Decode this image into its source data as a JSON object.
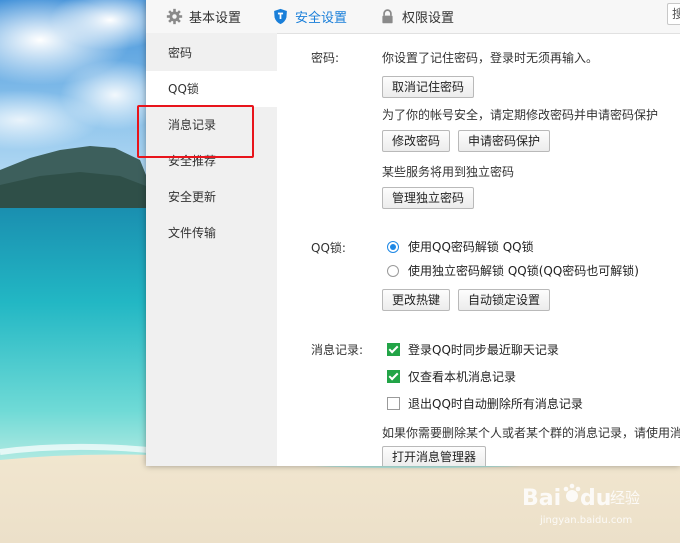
{
  "tabs": [
    {
      "label": "基本设置",
      "icon": "gear-icon"
    },
    {
      "label": "安全设置",
      "icon": "shield-icon",
      "active": true
    },
    {
      "label": "权限设置",
      "icon": "lock-icon"
    }
  ],
  "search": {
    "value": "搜"
  },
  "sidebar": {
    "items": [
      {
        "label": "密码"
      },
      {
        "label": "QQ锁",
        "active": true
      },
      {
        "label": "消息记录"
      },
      {
        "label": "安全推荐"
      },
      {
        "label": "安全更新"
      },
      {
        "label": "文件传输"
      }
    ]
  },
  "password": {
    "label": "密码:",
    "remembered_text": "你设置了记住密码，登录时无须再输入。",
    "cancel_remember_button": "取消记住密码",
    "advice_text": "为了你的帐号安全，请定期修改密码并申请密码保护",
    "change_password_button": "修改密码",
    "apply_protection_button": "申请密码保护",
    "independent_text": "某些服务将用到独立密码",
    "manage_independent_button": "管理独立密码"
  },
  "qqlock": {
    "label": "QQ锁:",
    "option1": "使用QQ密码解锁 QQ锁",
    "option2": "使用独立密码解锁 QQ锁(QQ密码也可解锁)",
    "selected": 1,
    "hotkey_button": "更改热键",
    "autolock_button": "自动锁定设置"
  },
  "messages": {
    "label": "消息记录:",
    "check1": "登录QQ时同步最近聊天记录",
    "check1_checked": true,
    "check2": "仅查看本机消息记录",
    "check2_checked": true,
    "check3": "退出QQ时自动删除所有消息记录",
    "check3_checked": false,
    "delete_hint": "如果你需要删除某个人或者某个群的消息记录，请使用消",
    "open_manager_button": "打开消息管理器"
  },
  "watermark": {
    "brand": "Bai",
    "brand2": "du",
    "jingyan": "经验",
    "url": "jingyan.baidu.com"
  },
  "colors": {
    "accent": "#1a7fd9",
    "check_green": "#22a447",
    "highlight_red": "#e8141b"
  }
}
